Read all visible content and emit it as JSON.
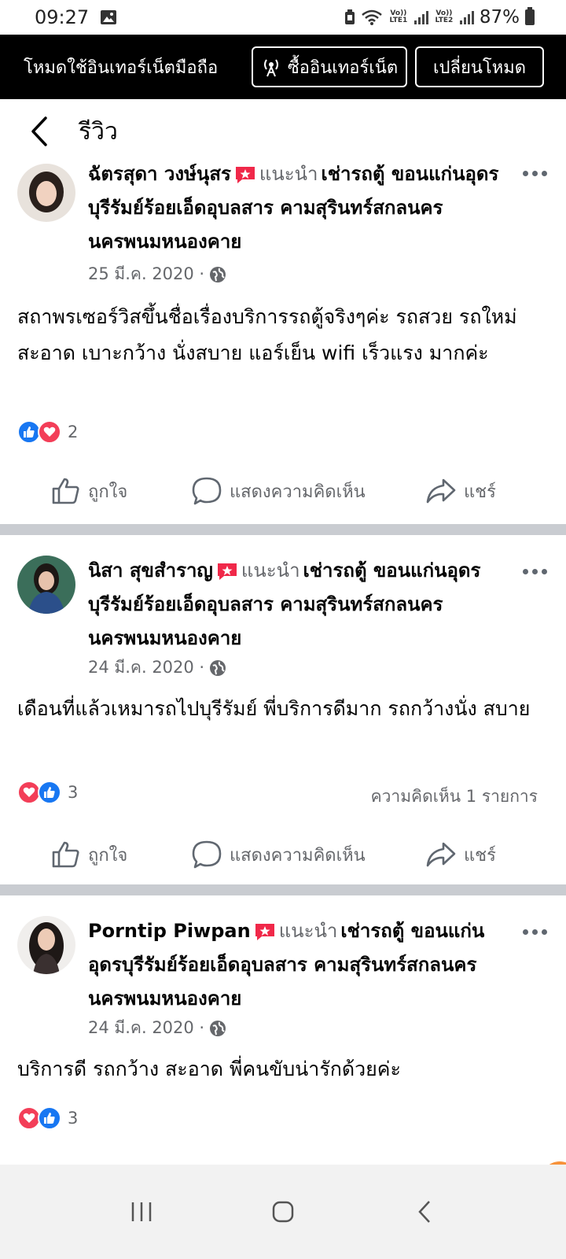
{
  "status_bar": {
    "time": "09:27",
    "sim1_label": "Vo)) LTE1",
    "sim2_label": "Vo)) LTE2",
    "battery": "87%"
  },
  "mode_banner": {
    "label": "โหมดใช้อินเทอร์เน็ตมือถือ",
    "buy_button": "ซื้ออินเทอร์เน็ต",
    "switch_button": "เปลี่ยนโหมด"
  },
  "header": {
    "title": "รีวิว"
  },
  "posts": [
    {
      "author": "ฉัตรสุดา วงษ์นุสร",
      "recommends": "แนะนำ",
      "page_name": "เช่ารถตู้ ขอนแก่นอุดรบุรีรัมย์ร้อยเอ็ดอุบลสาร คามสุรินทร์สกลนครนครพนมหนองคาย",
      "date": "25 มี.ค. 2020 ·",
      "body": "สถาพรเซอร์วิสขึ้นชื่อเรื่องบริการรถตู้จริงๆค่ะ รถสวย รถใหม่ สะอาด เบาะกว้าง นั่งสบาย แอร์เย็น wifi เร็วแรง มากค่ะ",
      "reaction_count": "2",
      "comment_count": "",
      "avatar_color": "#3a2c2a"
    },
    {
      "author": "นิสา สุขสำราญ",
      "recommends": "แนะนำ",
      "page_name": "เช่ารถตู้ ขอนแก่นอุดรบุรีรัมย์ร้อยเอ็ดอุบลสาร คามสุรินทร์สกลนครนครพนมหนองคาย",
      "date": "24 มี.ค. 2020 ·",
      "body": "เดือนที่แล้วเหมารถไปบุรีรัมย์ พี่บริการดีมาก รถกว้างนั่ง สบาย",
      "reaction_count": "3",
      "comment_count": "ความคิดเห็น 1 รายการ",
      "avatar_color": "#2f4f7a"
    },
    {
      "author": "Porntip Piwpan",
      "recommends": "แนะนำ",
      "page_name": "เช่ารถตู้ ขอนแก่นอุดรบุรีรัมย์ร้อยเอ็ดอุบลสาร คามสุรินทร์สกลนครนครพนมหนองคาย",
      "date": "24 มี.ค. 2020 ·",
      "body": "บริการดี รถกว้าง สะอาด พี่คนขับน่ารักด้วยค่ะ",
      "reaction_count": "3",
      "comment_count": "",
      "avatar_color": "#5a4a4a"
    }
  ],
  "actions": {
    "like": "ถูกใจ",
    "comment": "แสดงความคิดเห็น",
    "share": "แชร์"
  },
  "colors": {
    "like_blue": "#1877f2",
    "love_red": "#f33e58",
    "recommend_red": "#f02849",
    "muted_text": "#65676b",
    "divider": "#c9ccd1"
  }
}
